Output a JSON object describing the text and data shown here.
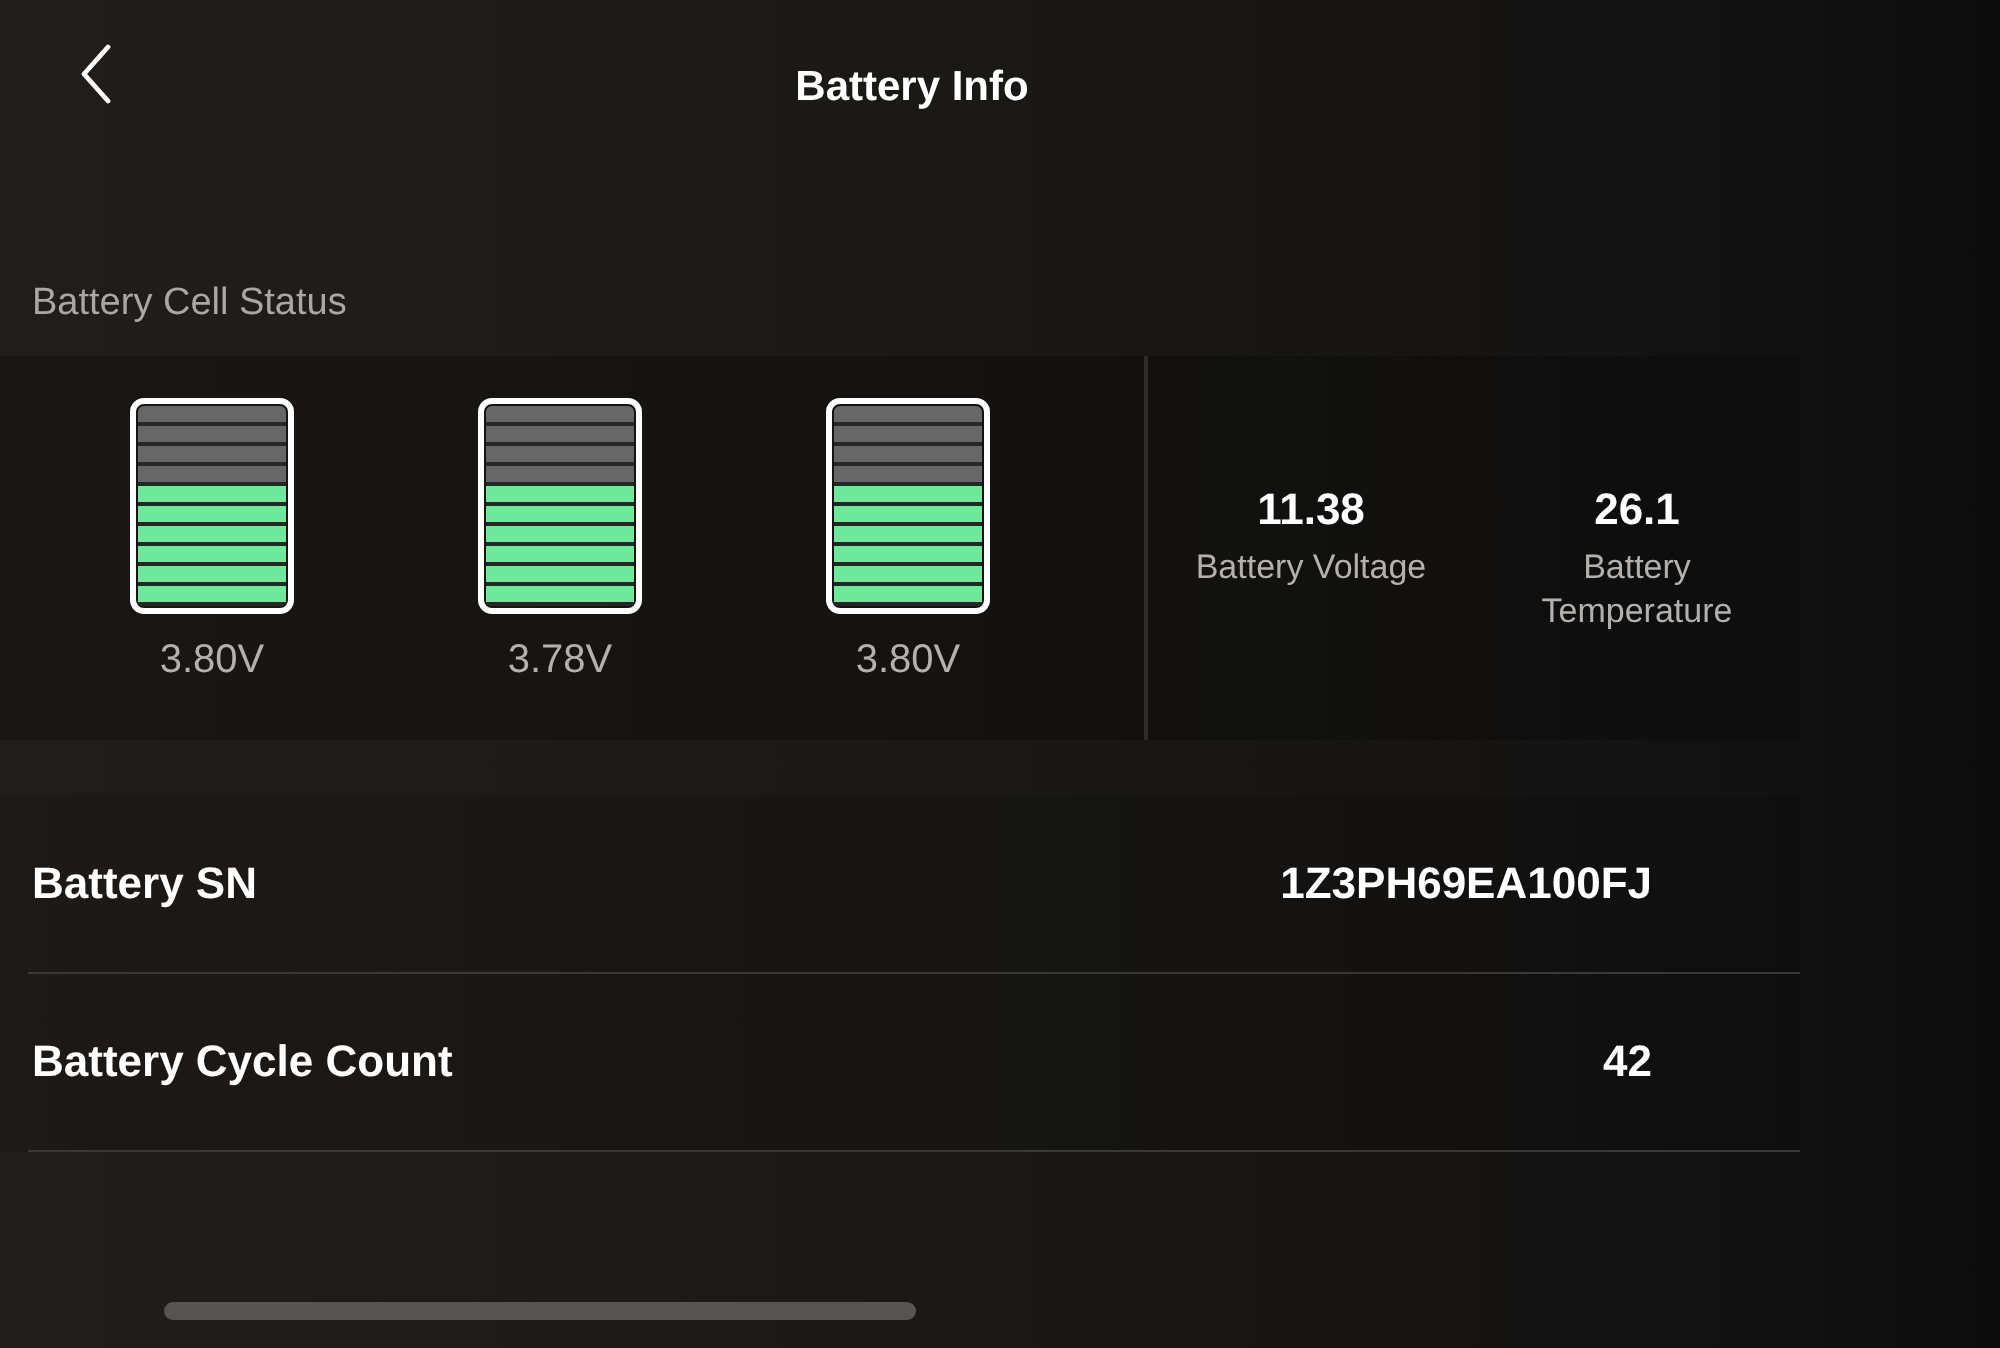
{
  "header": {
    "title": "Battery Info"
  },
  "cell_status": {
    "label": "Battery Cell Status",
    "cells": [
      {
        "level": 0.6,
        "voltage": "3.80V"
      },
      {
        "level": 0.6,
        "voltage": "3.78V"
      },
      {
        "level": 0.6,
        "voltage": "3.80V"
      }
    ],
    "stats": [
      {
        "value": "11.38",
        "label": "Battery Voltage"
      },
      {
        "value": "26.1",
        "label": "Battery Temperature"
      }
    ]
  },
  "details": [
    {
      "label": "Battery SN",
      "value": "1Z3PH69EA100FJ"
    },
    {
      "label": "Battery Cycle Count",
      "value": "42"
    }
  ]
}
